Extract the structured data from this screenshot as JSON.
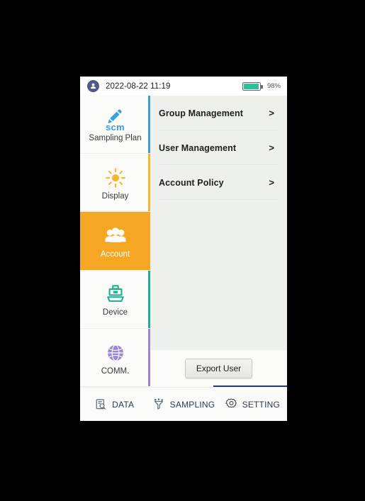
{
  "status_bar": {
    "avatar_icon": "user-avatar-icon",
    "datetime": "2022-08-22 11:19",
    "battery_icon": "battery-icon",
    "battery_percent": "98%"
  },
  "sidebar": {
    "items": [
      {
        "label": "Sampling Plan",
        "icon": "pen-scm-icon",
        "sub_text": "scm",
        "accent": "#3aa0dd",
        "active": false
      },
      {
        "label": "Display",
        "icon": "sun-icon",
        "accent": "#f5b731",
        "active": false
      },
      {
        "label": "Account",
        "icon": "users-group-icon",
        "accent": "#f5a623",
        "active": true
      },
      {
        "label": "Device",
        "icon": "device-icon",
        "accent": "#1fae8f",
        "active": false
      },
      {
        "label": "COMM.",
        "icon": "globe-icon",
        "accent": "#9a86d4",
        "active": false
      }
    ]
  },
  "main": {
    "menu_items": [
      {
        "label": "Group Management",
        "chevron": ">"
      },
      {
        "label": "User Management",
        "chevron": ">"
      },
      {
        "label": "Account Policy",
        "chevron": ">"
      }
    ],
    "export_button": "Export User"
  },
  "bottom_nav": {
    "items": [
      {
        "label": "DATA",
        "icon": "data-document-search-icon",
        "active": false
      },
      {
        "label": "SAMPLING",
        "icon": "sampling-funnel-icon",
        "active": false
      },
      {
        "label": "SETTING",
        "icon": "gear-icon",
        "active": true
      }
    ],
    "active_indicator_color": "#253b6e"
  }
}
